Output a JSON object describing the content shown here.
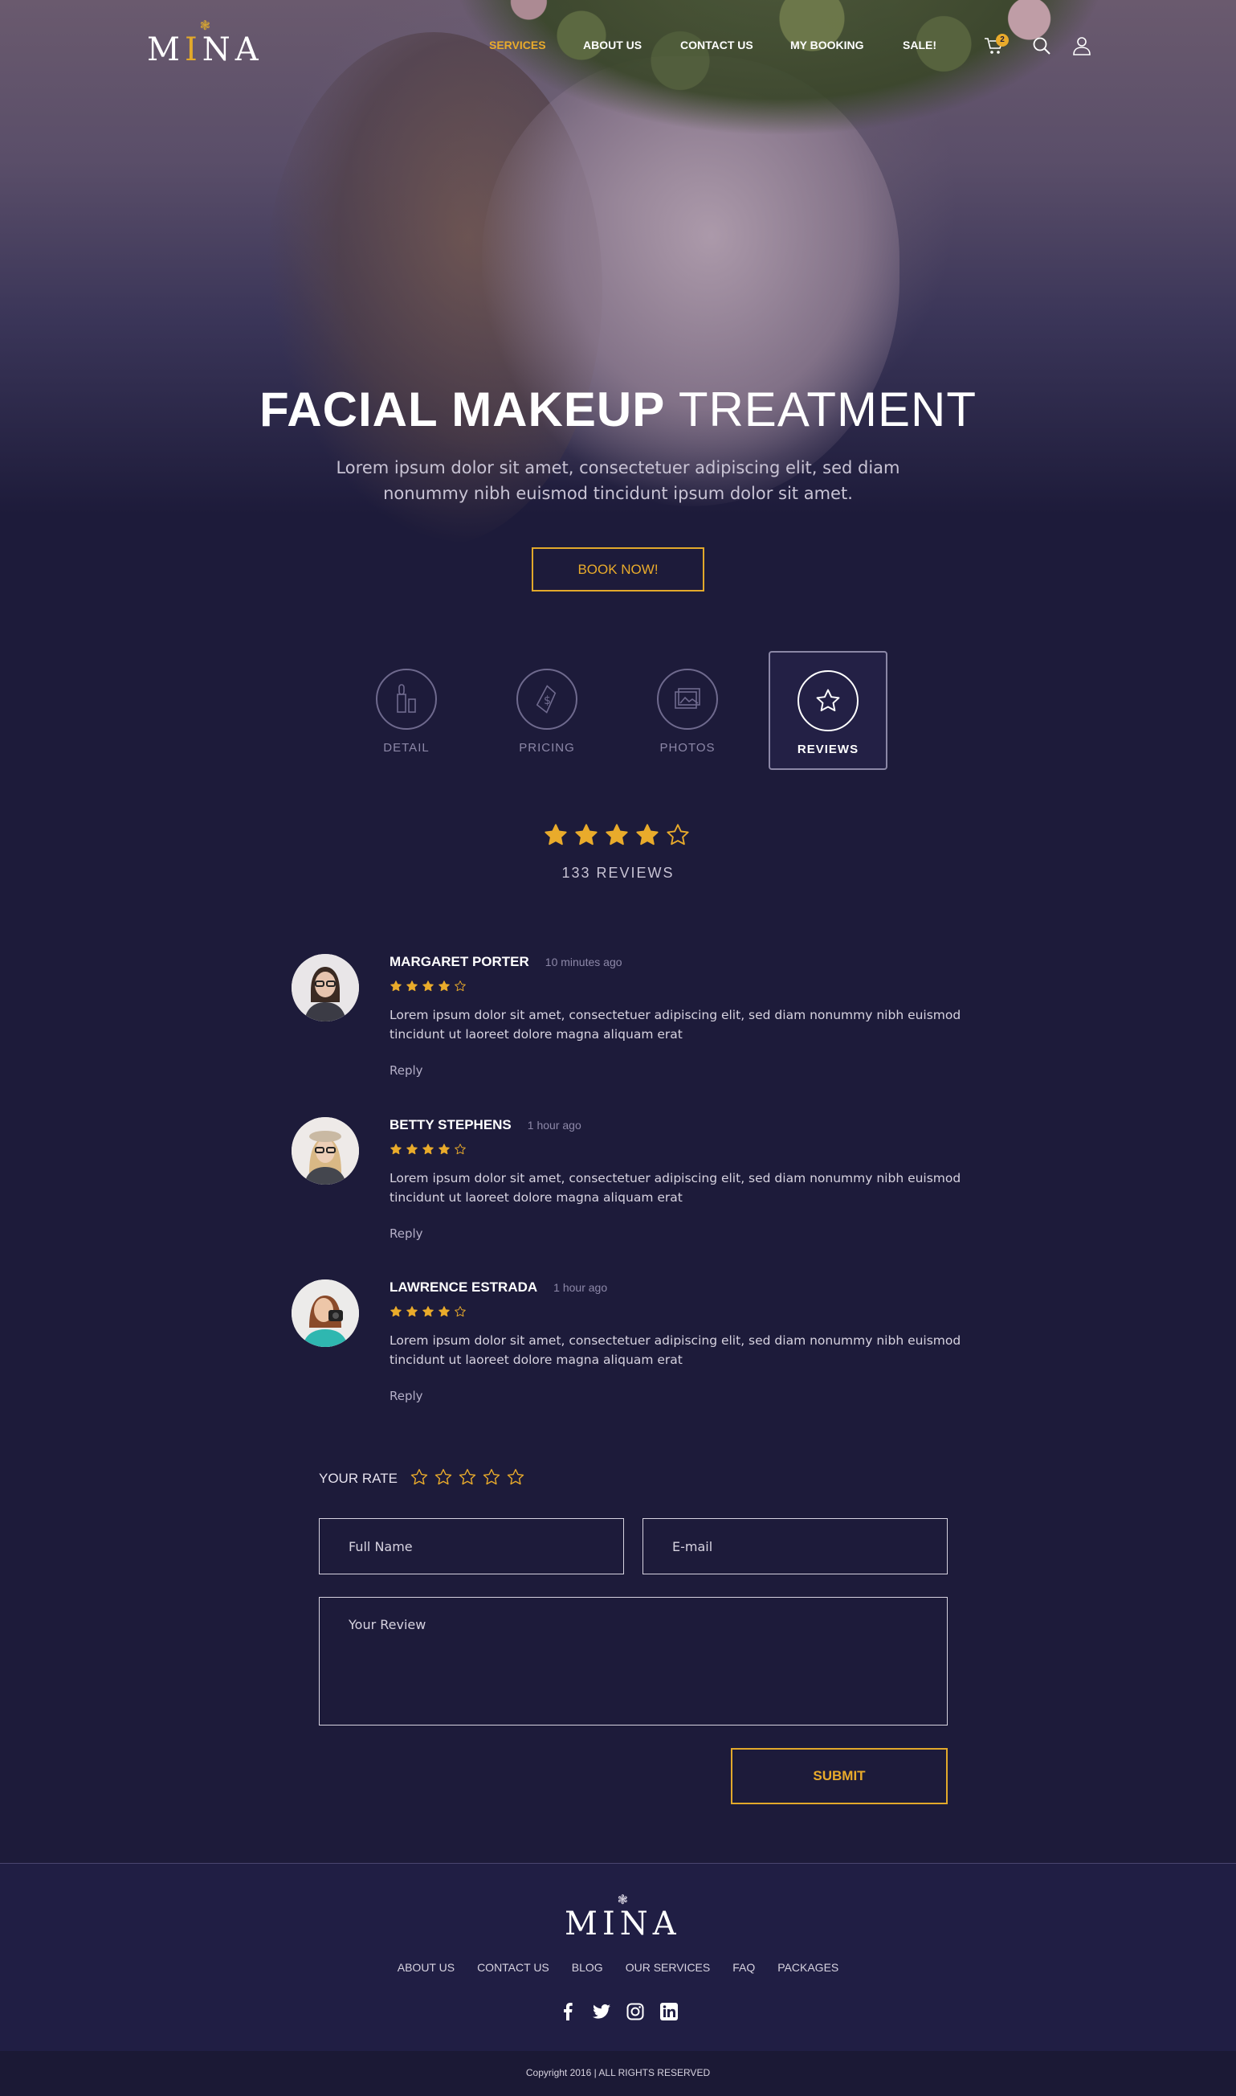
{
  "brand": {
    "logo_text_prefix": "M",
    "logo_text_gold": "I",
    "logo_text_suffix": "NA"
  },
  "nav": {
    "items": [
      {
        "label": "SERVICES",
        "active": true
      },
      {
        "label": "ABOUT US"
      },
      {
        "label": "CONTACT US"
      },
      {
        "label": "MY BOOKING"
      },
      {
        "label": "SALE!"
      }
    ],
    "cart_count": "2",
    "icons": [
      "cart-icon",
      "search-icon",
      "user-icon"
    ]
  },
  "hero": {
    "title_bold": "FACIAL MAKEUP",
    "title_light": "TREATMENT",
    "subtitle": "Lorem ipsum dolor sit amet, consectetuer adipiscing elit, sed diam nonummy nibh euismod tincidunt ipsum dolor sit amet.",
    "cta": "BOOK NOW!"
  },
  "tabs": [
    {
      "label": "DETAIL",
      "icon": "lipstick-icon"
    },
    {
      "label": "PRICING",
      "icon": "price-tag-icon"
    },
    {
      "label": "PHOTOS",
      "icon": "photos-icon"
    },
    {
      "label": "REVIEWS",
      "icon": "star-icon",
      "active": true
    }
  ],
  "rating_summary": {
    "rating": 4,
    "max": 5,
    "count_text": "133 REVIEWS"
  },
  "reviews": [
    {
      "name": "MARGARET PORTER",
      "time": "10 minutes ago",
      "rating": 4,
      "text": "Lorem ipsum dolor sit amet, consectetuer adipiscing elit, sed diam nonummy nibh euismod tincidunt ut laoreet dolore magna aliquam erat",
      "reply": "Reply"
    },
    {
      "name": "BETTY STEPHENS",
      "time": "1 hour ago",
      "rating": 4,
      "text": "Lorem ipsum dolor sit amet, consectetuer adipiscing elit, sed diam nonummy nibh euismod tincidunt ut laoreet dolore magna aliquam erat",
      "reply": "Reply"
    },
    {
      "name": "LAWRENCE ESTRADA",
      "time": "1 hour ago",
      "rating": 4,
      "text": "Lorem ipsum dolor sit amet, consectetuer adipiscing elit, sed diam nonummy nibh euismod tincidunt ut laoreet dolore magna aliquam erat",
      "reply": "Reply"
    }
  ],
  "form": {
    "rate_label": "YOUR RATE",
    "rate_value": 0,
    "name_placeholder": "Full Name",
    "email_placeholder": "E-mail",
    "review_placeholder": "Your Review",
    "submit": "SUBMIT"
  },
  "footer": {
    "links": [
      "ABOUT US",
      "CONTACT US",
      "BLOG",
      "OUR SERVICES",
      "FAQ",
      "PACKAGES"
    ],
    "social": [
      "facebook-icon",
      "twitter-icon",
      "instagram-icon",
      "linkedin-icon"
    ],
    "copyright": "Copyright 2016 | ALL RIGHTS RESERVED"
  },
  "colors": {
    "accent": "#e9ab2b",
    "background": "#1d1b3a",
    "footer": "#201e44"
  }
}
